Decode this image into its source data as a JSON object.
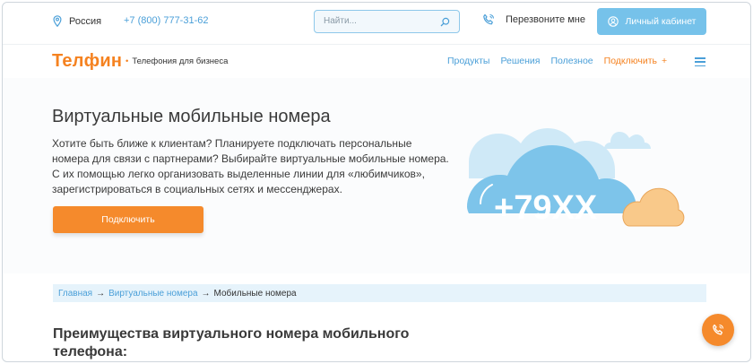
{
  "topbar": {
    "location": "Россия",
    "phone": "+7 (800) 777-31-62",
    "search_placeholder": "Найти...",
    "callback": "Перезвоните мне",
    "cabinet": "Личный кабинет"
  },
  "nav": {
    "logo": "Телфин",
    "tagline": "Телефония для бизнеса",
    "links": [
      "Продукты",
      "Решения",
      "Полезное"
    ],
    "connect": "Подключить",
    "connect_plus": "+"
  },
  "hero": {
    "title": "Виртуальные мобильные номера",
    "lead": "Хотите быть ближе к клиентам? Планируете подключать персональные номера для связи с партнерами? Выбирайте виртуальные мобильные номера. С их помощью легко организовать выделенные линии для «любимчиков», зарегистрироваться в социальных сетях и мессенджерах.",
    "cta": "Подключить",
    "illustration_text": "+79XX"
  },
  "breadcrumb": {
    "items": [
      "Главная",
      "Виртуальные номера"
    ],
    "arrow": "→",
    "current": "Мобильные номера"
  },
  "section": {
    "title": "Преимущества виртуального номера мобильного телефона:"
  },
  "colors": {
    "brand_orange": "#f58220",
    "link_blue": "#4a9fd8",
    "cloud_blue": "#7dc4ea",
    "cloud_light": "#cfe9f7",
    "cloud_orange": "#f9c98a"
  },
  "icons": {
    "location": "location-pin-icon",
    "search": "search-icon",
    "callback": "phone-callback-icon",
    "user": "user-icon",
    "menu": "hamburger-menu-icon",
    "fab": "phone-icon"
  }
}
